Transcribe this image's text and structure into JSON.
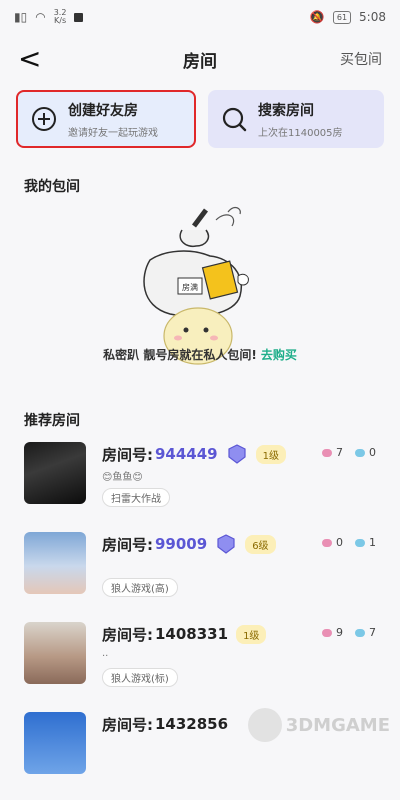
{
  "status": {
    "speed_value": "3.2",
    "speed_unit": "K/s",
    "battery": "61",
    "time": "5:08"
  },
  "topbar": {
    "back_glyph": "<",
    "title": "房间",
    "buy_label": "买包间"
  },
  "cards": {
    "create": {
      "title": "创建好友房",
      "subtitle": "邀请好友一起玩游戏"
    },
    "search": {
      "title": "搜索房间",
      "subtitle": "上次在1140005房"
    }
  },
  "my_rooms": {
    "title": "我的包间",
    "sign_text": "房满",
    "promo_text": "私密趴 靓号房就在私人包间!",
    "promo_link": "去购买"
  },
  "recommend": {
    "title": "推荐房间",
    "rooms": [
      {
        "label": "房间号:",
        "number": "944449",
        "level": "1级",
        "note": "😊鱼鱼😊",
        "tag": "扫雷大作战",
        "stat_a": "7",
        "stat_b": "0"
      },
      {
        "label": "房间号:",
        "number": "99009",
        "level": "6级",
        "note": "",
        "tag": "狼人游戏(高)",
        "stat_a": "0",
        "stat_b": "1"
      },
      {
        "label": "房间号:",
        "number": "1408331",
        "level": "1级",
        "note": "..",
        "tag": "狼人游戏(标)",
        "stat_a": "9",
        "stat_b": "7"
      },
      {
        "label": "房间号:",
        "number": "1432856",
        "level": "",
        "note": "",
        "tag": "",
        "stat_a": "",
        "stat_b": ""
      }
    ]
  },
  "watermark": {
    "text": "3DMGAME"
  },
  "colors": {
    "accent_purple": "#5b56d4",
    "link_green": "#1fae8a",
    "highlight_red": "#e0282a"
  }
}
